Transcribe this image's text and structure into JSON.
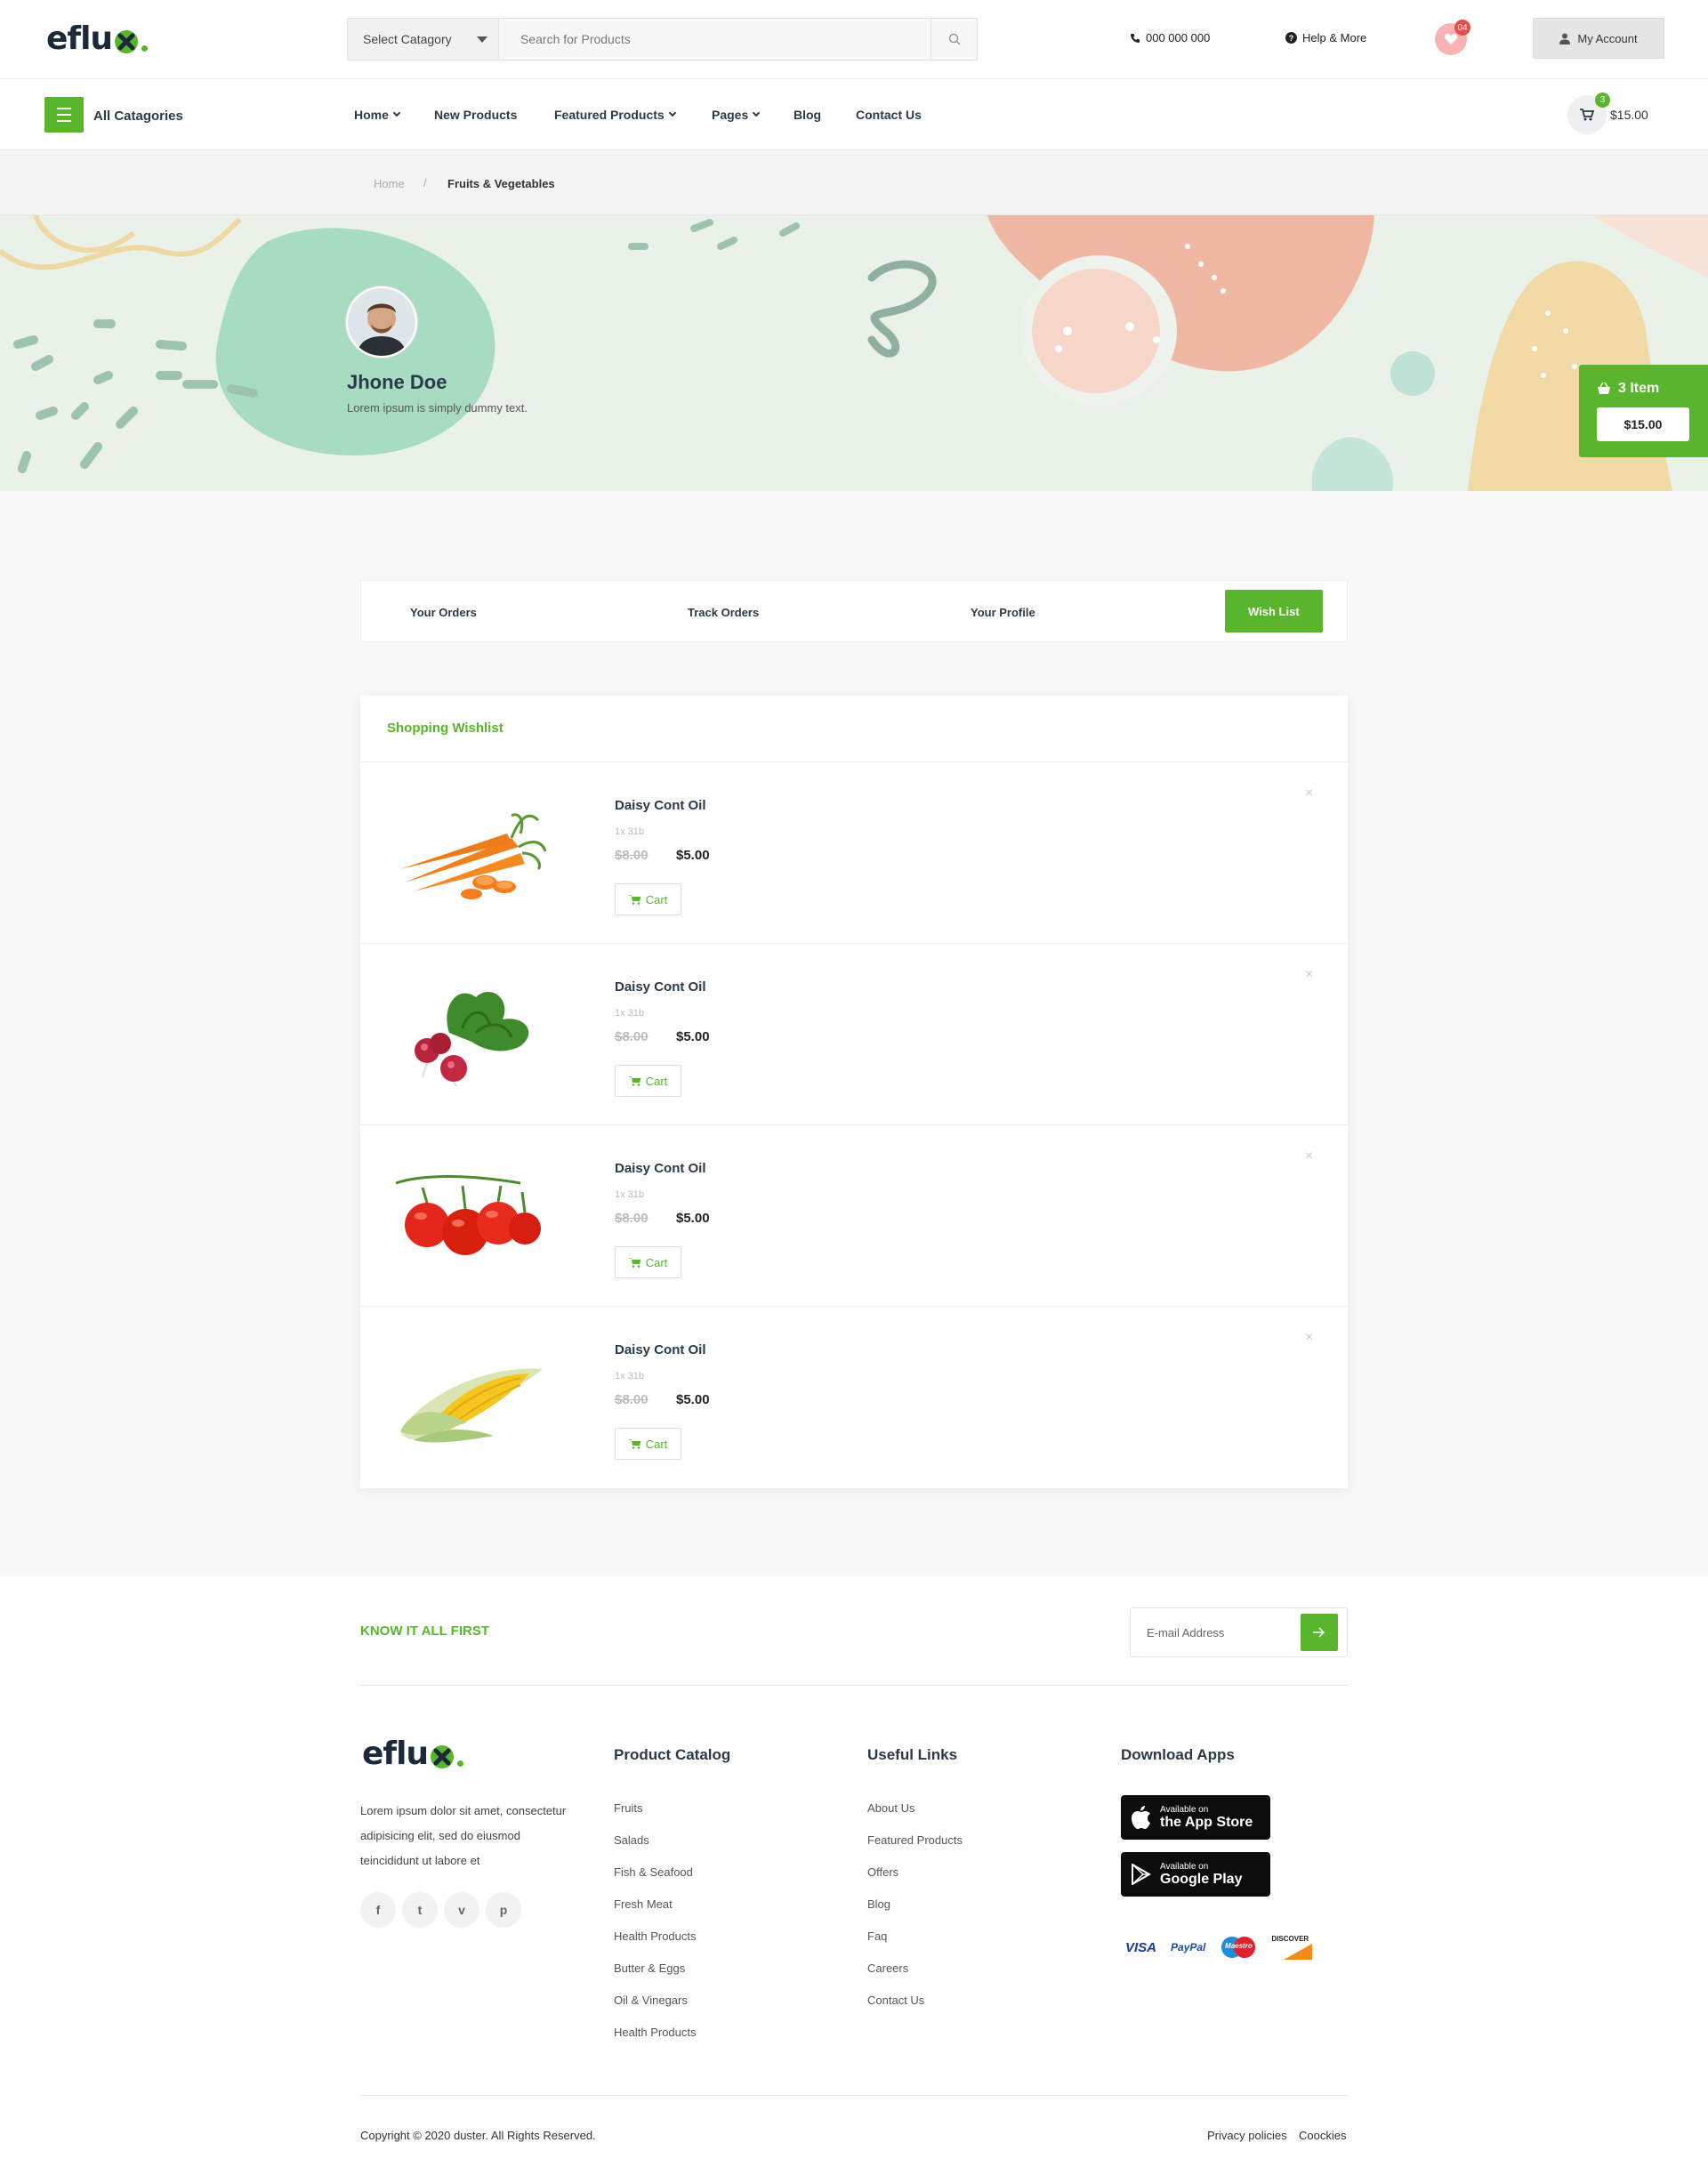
{
  "header": {
    "logo_main": "eflu",
    "logo_x": "x",
    "category_select": "Select Catagory",
    "search_placeholder": "Search for Products",
    "phone": "000 000 000",
    "help": "Help & More",
    "wishlist_count": "04",
    "account": "My Account"
  },
  "nav": {
    "all_categories": "All Catagories",
    "links": [
      {
        "label": "Home",
        "has_dropdown": true
      },
      {
        "label": "New Products",
        "has_dropdown": false
      },
      {
        "label": "Featured Products",
        "has_dropdown": true
      },
      {
        "label": "Pages",
        "has_dropdown": true
      },
      {
        "label": "Blog",
        "has_dropdown": false
      },
      {
        "label": "Contact Us",
        "has_dropdown": false
      }
    ],
    "cart_count": "3",
    "cart_total": "$15.00"
  },
  "breadcrumb": {
    "home": "Home",
    "separator": "/",
    "current": "Fruits & Vegetables"
  },
  "profile": {
    "name": "Jhone Doe",
    "bio": "Lorem ipsum is simply dummy text."
  },
  "side_cart": {
    "count": "3 Item",
    "total": "$15.00"
  },
  "tabs": [
    {
      "label": "Your Orders",
      "active": false
    },
    {
      "label": "Track Orders",
      "active": false
    },
    {
      "label": "Your Profile",
      "active": false
    },
    {
      "label": "Wish List",
      "active": true
    }
  ],
  "wishlist": {
    "title": "Shopping Wishlist",
    "cart_label": "Cart",
    "remove_symbol": "×",
    "items": [
      {
        "name": "Daisy Cont Oil",
        "qty": "1x 31b",
        "old_price": "$8.00",
        "price": "$5.00",
        "image": "carrot"
      },
      {
        "name": "Daisy Cont Oil",
        "qty": "1x 31b",
        "old_price": "$8.00",
        "price": "$5.00",
        "image": "radish"
      },
      {
        "name": "Daisy Cont Oil",
        "qty": "1x 31b",
        "old_price": "$8.00",
        "price": "$5.00",
        "image": "tomato"
      },
      {
        "name": "Daisy Cont Oil",
        "qty": "1x 31b",
        "old_price": "$8.00",
        "price": "$5.00",
        "image": "corn"
      }
    ]
  },
  "newsletter": {
    "title": "KNOW IT ALL FIRST",
    "placeholder": "E-mail Address"
  },
  "footer": {
    "about": "Lorem ipsum dolor sit amet, consectetur adipisicing elit, sed do eiusmod teincididunt ut labore et",
    "social": [
      "f",
      "t",
      "v",
      "p"
    ],
    "catalog_title": "Product Catalog",
    "catalog_links": [
      "Fruits",
      "Salads",
      "Fish & Seafood",
      "Fresh Meat",
      "Health Products",
      "Butter & Eggs",
      "Oil & Vinegars",
      "Health Products"
    ],
    "useful_title": "Useful Links",
    "useful_links": [
      "About Us",
      "Featured Products",
      "Offers",
      "Blog",
      "Faq",
      "Careers",
      "Contact Us"
    ],
    "apps_title": "Download Apps",
    "app_store": {
      "small": "Available on",
      "big": "the App Store"
    },
    "google_play": {
      "small": "Available on",
      "big": "Google Play"
    },
    "payments": [
      "VISA",
      "PayPal",
      "Maestro",
      "DISCOVER"
    ],
    "copyright": "Copyright © 2020 duster. All Rights Reserved.",
    "privacy": "Privacy policies",
    "cookies": "Coockies"
  },
  "colors": {
    "accent": "#59b62c",
    "text_dark": "#2b3a48",
    "wishlist_badge": "#e84c4c"
  }
}
